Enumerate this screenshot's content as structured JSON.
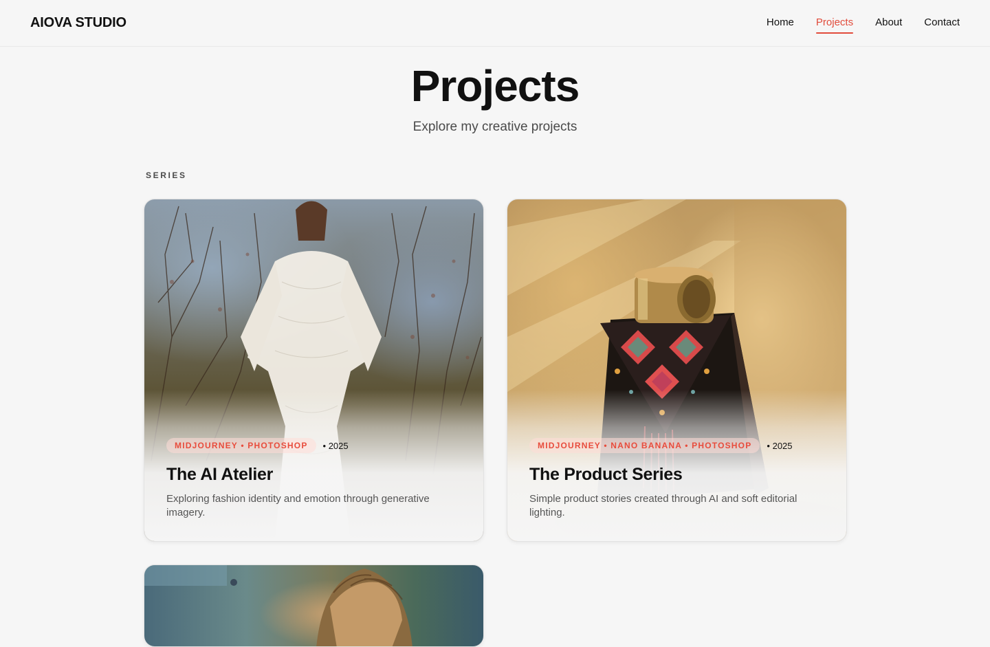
{
  "header": {
    "brand": "AIOVA STUDIO",
    "nav": [
      {
        "label": "Home",
        "active": false
      },
      {
        "label": "Projects",
        "active": true
      },
      {
        "label": "About",
        "active": false
      },
      {
        "label": "Contact",
        "active": false
      }
    ]
  },
  "hero": {
    "title": "Projects",
    "subtitle": "Explore my creative projects"
  },
  "section": {
    "label": "SERIES"
  },
  "cards": [
    {
      "tools": "MIDJOURNEY • PHOTOSHOP",
      "year": "• 2025",
      "title": "The AI Atelier",
      "description": "Exploring fashion identity and emotion through generative imagery."
    },
    {
      "tools": "MIDJOURNEY • NANO BANANA • PHOTOSHOP",
      "year": "• 2025",
      "title": "The Product Series",
      "description": "Simple product stories created through AI and soft editorial lighting."
    }
  ],
  "colors": {
    "accent": "#e14b3b",
    "background": "#f6f6f6",
    "text": "#111111"
  }
}
